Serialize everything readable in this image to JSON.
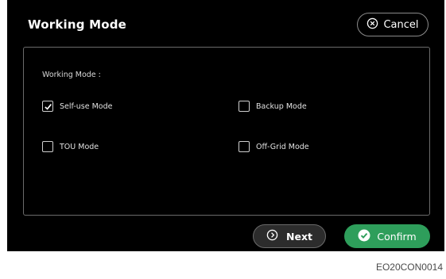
{
  "dialog": {
    "title": "Working Mode",
    "cancel_label": "Cancel"
  },
  "panel": {
    "label": "Working Mode :",
    "options": [
      {
        "label": "Self-use Mode",
        "checked": true
      },
      {
        "label": "Backup Mode",
        "checked": false
      },
      {
        "label": "TOU Mode",
        "checked": false
      },
      {
        "label": "Off-Grid Mode",
        "checked": false
      }
    ]
  },
  "footer": {
    "next_label": "Next",
    "confirm_label": "Confirm"
  },
  "figure_code": "EO20CON0014",
  "colors": {
    "background": "#000000",
    "confirm": "#2e9e5b",
    "border": "#6b6b6b"
  },
  "icons": [
    "close-circle-icon",
    "checkmark-icon",
    "chevron-right-circle-icon",
    "check-circle-icon"
  ]
}
